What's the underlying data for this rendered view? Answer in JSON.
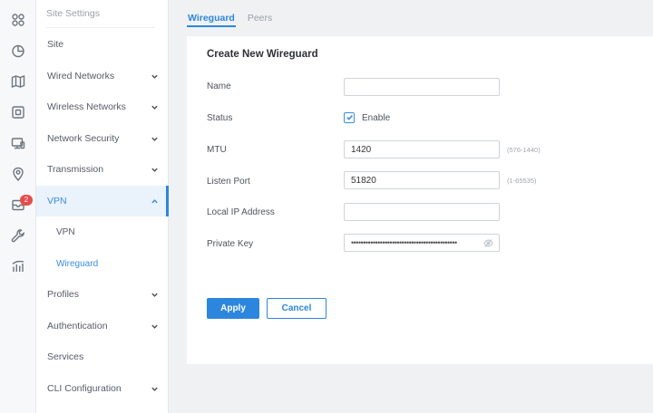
{
  "rail": {
    "items": [
      {
        "icon": "grid-icon"
      },
      {
        "icon": "clock-icon"
      },
      {
        "icon": "map-icon"
      },
      {
        "icon": "device-icon"
      },
      {
        "icon": "monitor-icon"
      },
      {
        "icon": "location-pin-icon"
      },
      {
        "icon": "alerts-icon",
        "badge": "2"
      },
      {
        "icon": "wrench-icon"
      },
      {
        "icon": "stats-icon"
      }
    ],
    "badge_color": "#e74c4c"
  },
  "subnav": {
    "header": "Site Settings",
    "items": [
      {
        "label": "Site"
      },
      {
        "label": "Wired Networks"
      },
      {
        "label": "Wireless Networks"
      },
      {
        "label": "Network Security"
      },
      {
        "label": "Transmission"
      },
      {
        "label": "VPN",
        "expanded": true
      },
      {
        "label": "VPN"
      },
      {
        "label": "Wireguard",
        "selected": true
      },
      {
        "label": "Profiles"
      },
      {
        "label": "Authentication"
      },
      {
        "label": "Services"
      },
      {
        "label": "CLI Configuration"
      }
    ]
  },
  "tabs": [
    {
      "label": "Wireguard",
      "active": true
    },
    {
      "label": "Peers"
    }
  ],
  "form": {
    "title": "Create New Wireguard",
    "name_label": "Name",
    "name_value": "",
    "status_label": "Status",
    "status_option": "Enable",
    "status_checked": true,
    "mtu_label": "MTU",
    "mtu_value": "1420",
    "mtu_hint": "(576-1440)",
    "port_label": "Listen Port",
    "port_value": "51820",
    "port_hint": "(1-65535)",
    "local_ip_label": "Local IP Address",
    "local_ip_value": "",
    "private_key_label": "Private Key",
    "private_key_mask": "••••••••••••••••••••••••••••••••••••••••••••"
  },
  "actions": {
    "apply": "Apply",
    "cancel": "Cancel"
  },
  "colors": {
    "accent": "#2d86dd",
    "active_bg": "#eaf2fb"
  }
}
